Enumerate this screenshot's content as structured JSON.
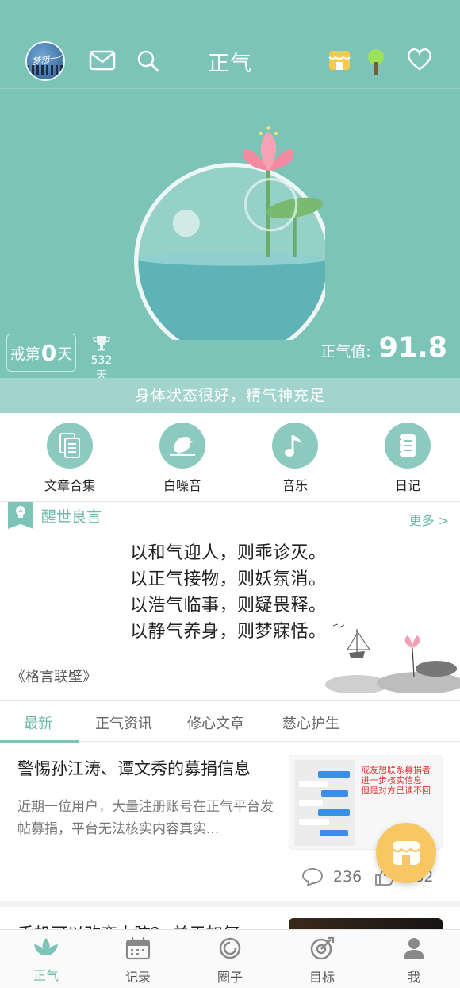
{
  "header": {
    "title": "正气",
    "avatar_text": "梦想一个救命金"
  },
  "hero": {
    "streak_prefix": "戒第",
    "streak_days": "0",
    "streak_suffix": "天",
    "best_record": "532天",
    "zhengqi_label": "正气值:",
    "zhengqi_value": "91.8",
    "status_text": "身体状态很好，精气神充足"
  },
  "shortcuts": [
    {
      "label": "文章合集",
      "icon": "document-icon"
    },
    {
      "label": "白噪音",
      "icon": "bird-icon"
    },
    {
      "label": "音乐",
      "icon": "music-note-icon"
    },
    {
      "label": "日记",
      "icon": "notebook-icon"
    }
  ],
  "quote": {
    "title": "醒世良言",
    "more": "更多 >",
    "lines": [
      "以和气迎人，则乖诊灭。",
      "以正气接物，则妖氛消。",
      "以浩气临事，则疑畏释。",
      "以静气养身，则梦寐恬。"
    ],
    "source": "《格言联壁》"
  },
  "tabs": [
    "最新",
    "正气资讯",
    "修心文章",
    "慈心护生"
  ],
  "articles": [
    {
      "title": "警惕孙江涛、谭文秀的募捐信息",
      "summary": "近期一位用户，大量注册账号在正气平台发帖募捐，平台无法核实内容真实...",
      "thumb_caption": [
        "戒友想联系募捐者",
        "进一步核实信息",
        "但是对方已读不回"
      ],
      "comments": "236",
      "likes": "362"
    },
    {
      "title": "手机可以改变大脑？ 关于如何"
    }
  ],
  "bottom_nav": [
    {
      "label": "正气",
      "icon": "lotus-icon"
    },
    {
      "label": "记录",
      "icon": "calendar-icon"
    },
    {
      "label": "圈子",
      "icon": "circle-icon"
    },
    {
      "label": "目标",
      "icon": "target-icon"
    },
    {
      "label": "我",
      "icon": "user-icon"
    }
  ],
  "colors": {
    "primary": "#7cc4b8",
    "accent_text": "#6cb8aa",
    "fab": "#f8c764",
    "status_bar": "#a1d4cc"
  }
}
